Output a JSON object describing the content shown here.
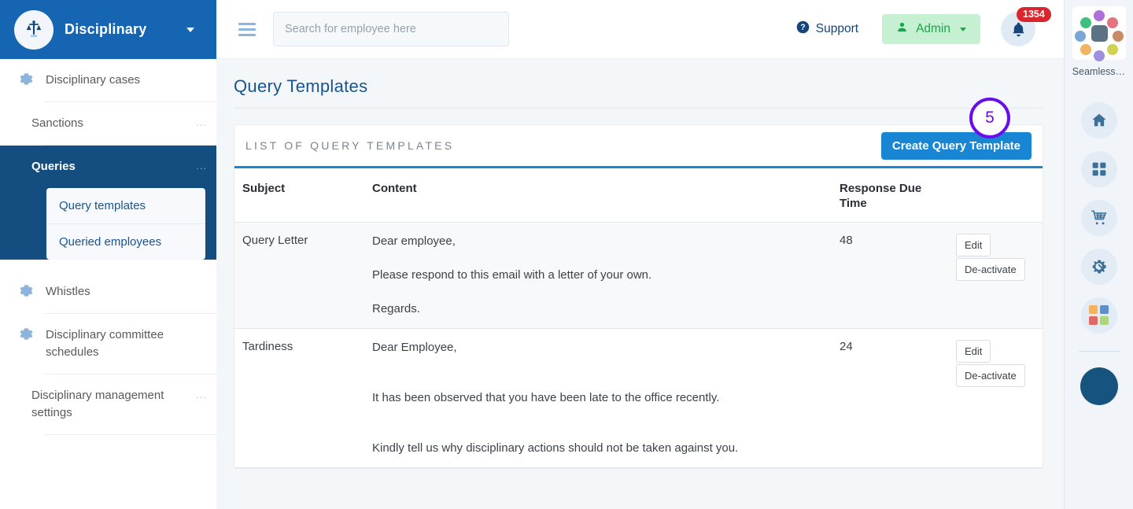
{
  "brand": {
    "name": "Disciplinary",
    "logo_icon": "scales-of-justice-icon"
  },
  "sidebar": {
    "items": [
      {
        "label": "Disciplinary cases",
        "icon": "gear-icon",
        "has_icon": true,
        "dots": "",
        "active": false
      },
      {
        "label": "Sanctions",
        "icon": "",
        "has_icon": false,
        "dots": "...",
        "active": false
      },
      {
        "label": "Queries",
        "icon": "",
        "has_icon": false,
        "dots": "...",
        "active": true
      },
      {
        "label": "Whistles",
        "icon": "gear-icon",
        "has_icon": true,
        "dots": "",
        "active": false
      },
      {
        "label": "Disciplinary committee schedules",
        "icon": "gear-icon",
        "has_icon": true,
        "dots": "",
        "active": false
      },
      {
        "label": "Disciplinary management settings",
        "icon": "",
        "has_icon": false,
        "dots": "...",
        "active": false
      }
    ],
    "submenu": [
      {
        "label": "Query templates"
      },
      {
        "label": "Queried employees"
      }
    ]
  },
  "topbar": {
    "menu_icon": "hamburger-icon",
    "search": {
      "placeholder": "Search for employee here",
      "value": ""
    },
    "support_label": "Support",
    "support_icon": "question-circle-icon",
    "admin_label": "Admin",
    "admin_icon": "user-icon",
    "bell_icon": "bell-icon",
    "notification_count": "1354"
  },
  "page": {
    "title": "Query Templates",
    "annotation_badge": "5"
  },
  "card": {
    "header_title": "LIST OF QUERY TEMPLATES",
    "create_button": "Create Query Template"
  },
  "table": {
    "columns": [
      "Subject",
      "Content",
      "Response Due Time",
      ""
    ],
    "rows": [
      {
        "subject": "Query Letter",
        "content": [
          "Dear employee,",
          "Please respond to this email with a letter of your own.",
          "Regards."
        ],
        "due_time": "48",
        "actions": [
          "Edit",
          "De-activate"
        ]
      },
      {
        "subject": "Tardiness",
        "content": [
          "Dear Employee,",
          "It has been observed that you have been late to the office recently.",
          "Kindly tell us why disciplinary actions should not be taken against you."
        ],
        "due_time": "24",
        "actions": [
          "Edit",
          "De-activate"
        ]
      }
    ]
  },
  "rail": {
    "caption": "Seamless…",
    "icons": [
      {
        "name": "home-icon"
      },
      {
        "name": "grid-apps-icon"
      },
      {
        "name": "shopping-cart-icon"
      },
      {
        "name": "gear-settings-icon"
      },
      {
        "name": "color-squares-icon"
      }
    ]
  },
  "colors": {
    "brand_blue": "#1565b3",
    "sidebar_active": "#144e80",
    "accent_blue": "#1886d3",
    "title_blue": "#1a5490",
    "admin_green": "#17a74a",
    "admin_green_bg": "#c6f0d2",
    "badge_red": "#d8262c",
    "annotation_purple": "#6a0dea",
    "rail_bg": "#f1f5fa",
    "fab_blue": "#17537f"
  }
}
